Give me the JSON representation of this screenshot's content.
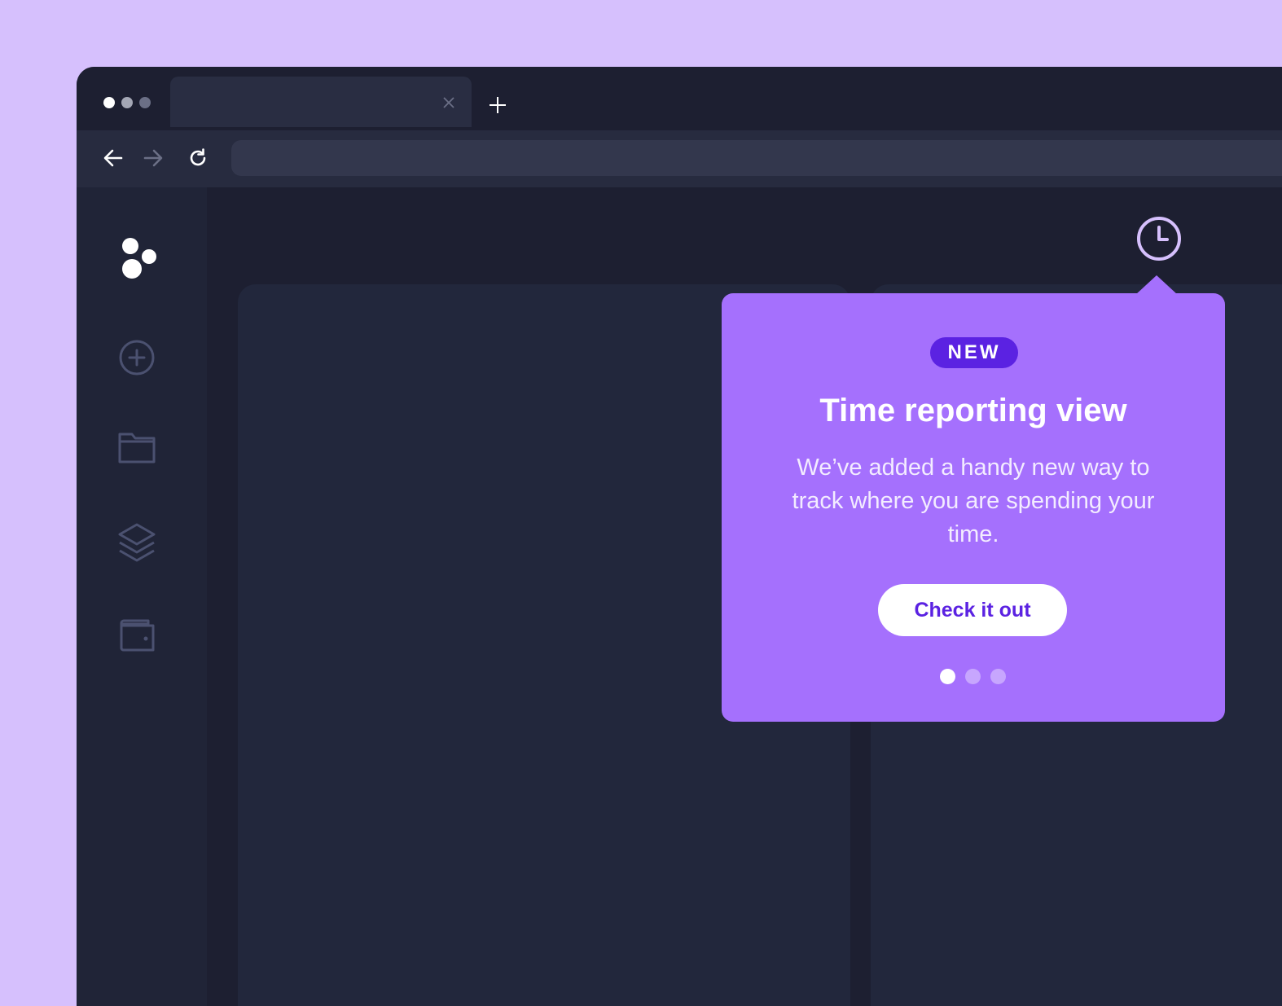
{
  "browser": {
    "window_dot_colors": [
      "#ffffff",
      "#a4a7b5",
      "#6b6f86"
    ],
    "tab": {
      "close_icon": "close-icon"
    },
    "new_tab_icon": "plus-icon",
    "toolbar": {
      "back_icon": "arrow-left-icon",
      "forward_icon": "arrow-right-icon",
      "reload_icon": "reload-icon",
      "address_value": ""
    }
  },
  "sidebar": {
    "logo_icon": "app-logo",
    "items": [
      {
        "icon": "plus-circle-icon"
      },
      {
        "icon": "folder-icon"
      },
      {
        "icon": "layers-icon"
      },
      {
        "icon": "wallet-icon"
      }
    ]
  },
  "header": {
    "clock_icon": "clock-icon"
  },
  "popover": {
    "badge": "NEW",
    "title": "Time reporting view",
    "body": "We’ve added a handy new way to track where you are spending your time.",
    "cta_label": "Check it out",
    "pager": {
      "total": 3,
      "active": 0
    },
    "colors": {
      "background": "#a570fd",
      "badge": "#5b22e2",
      "accent": "#5b22e2"
    }
  }
}
